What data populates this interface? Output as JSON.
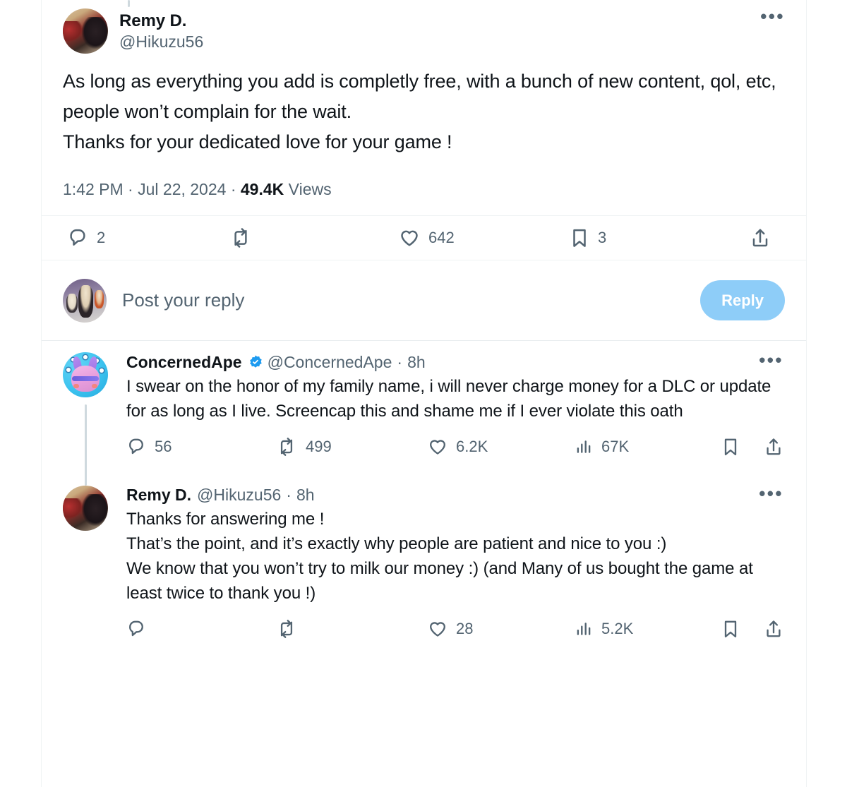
{
  "main_tweet": {
    "display_name": "Remy D.",
    "handle": "@Hikuzu56",
    "avatar_name": "remy-avatar",
    "body": "As long as everything you add is completly free, with a bunch of new content, qol, etc, people won’t complain for the wait.\nThanks for your dedicated love for your game !",
    "timestamp_time": "1:42 PM",
    "timestamp_sep1": "·",
    "timestamp_date": "Jul 22, 2024",
    "timestamp_sep2": "·",
    "views_count": "49.4K",
    "views_label": "Views",
    "more_glyph": "•••",
    "actions": {
      "reply_count": "2",
      "retweet_count": "",
      "like_count": "642",
      "bookmark_count": "3",
      "share_count": ""
    }
  },
  "composer": {
    "avatar_name": "user-avatar",
    "placeholder": "Post your reply",
    "reply_button_label": "Reply",
    "reply_button_color": "#8ecdf8",
    "reply_button_text_color": "#ffffff"
  },
  "replies": [
    {
      "display_name": "ConcernedApe",
      "verified": true,
      "handle": "@ConcernedApe",
      "separator": "·",
      "time": "8h",
      "avatar_name": "concernedape-avatar",
      "more_glyph": "•••",
      "body": "I swear on the honor of my family name,  i will never charge money for a DLC or update for as long as I live. Screencap this and shame me if I ever violate this oath",
      "actions": {
        "reply_count": "56",
        "retweet_count": "499",
        "like_count": "6.2K",
        "views_count": "67K"
      }
    },
    {
      "display_name": "Remy D.",
      "verified": false,
      "handle": "@Hikuzu56",
      "separator": "·",
      "time": "8h",
      "avatar_name": "remy-avatar",
      "more_glyph": "•••",
      "body": "Thanks for answering me !\nThat’s the point, and it’s exactly why people are patient and nice to you :)\nWe know that you won’t try to milk our money :) (and Many of us bought the game at least twice to thank you !)",
      "actions": {
        "reply_count": "",
        "retweet_count": "",
        "like_count": "28",
        "views_count": "5.2K"
      }
    }
  ],
  "colors": {
    "text_primary": "#0f1419",
    "text_secondary": "#536471",
    "border": "#eff3f4",
    "verified_blue": "#1d9bf0",
    "thread_line": "#cfd9de"
  },
  "icons": {
    "reply": "speech-bubble-icon",
    "retweet": "retweet-icon",
    "like": "heart-icon",
    "bookmark": "bookmark-icon",
    "share": "share-icon",
    "views": "analytics-bar-icon",
    "verified": "verified-badge-icon",
    "more": "more-options-icon"
  }
}
